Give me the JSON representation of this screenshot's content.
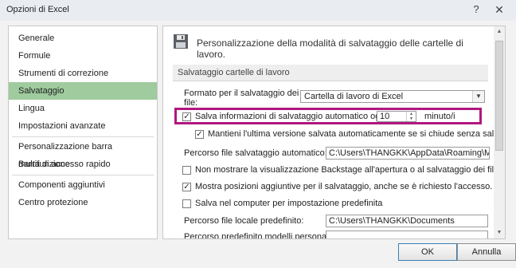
{
  "window": {
    "title": "Opzioni di Excel",
    "help_icon": "question-mark-icon",
    "close_icon": "close-icon"
  },
  "sidebar": {
    "items": [
      {
        "label": "Generale"
      },
      {
        "label": "Formule"
      },
      {
        "label": "Strumenti di correzione"
      },
      {
        "label": "Salvataggio",
        "selected": true
      },
      {
        "label": "Lingua"
      },
      {
        "label": "Impostazioni avanzate"
      },
      {
        "label": "Personalizzazione barra multifunzione"
      },
      {
        "label": "Barra di accesso rapido"
      },
      {
        "label": "Componenti aggiuntivi"
      },
      {
        "label": "Centro protezione"
      }
    ]
  },
  "header": {
    "icon": "floppy-disk-icon",
    "title": "Personalizzazione della modalità di salvataggio delle cartelle di lavoro."
  },
  "section": {
    "title": "Salvataggio cartelle di lavoro"
  },
  "format": {
    "label_line1": "Formato per il salvataggio dei",
    "label_line2": "file:",
    "value": "Cartella di lavoro di Excel"
  },
  "autosave": {
    "label": "Salva informazioni di salvataggio automatico ogni",
    "checked": true,
    "minutes": "10",
    "unit": "minuto/i",
    "highlight_color": "#b0177f"
  },
  "keep_last": {
    "label": "Mantieni l'ultima versione salvata automaticamente se si chiude senza salvare",
    "checked": true
  },
  "autorecover_path": {
    "label": "Percorso file salvataggio automatico:",
    "value": "C:\\Users\\THANGKK\\AppData\\Roaming\\Micr"
  },
  "no_backstage": {
    "label": "Non mostrare la visualizzazione Backstage all'apertura o al salvataggio dei file",
    "checked": false
  },
  "show_additional": {
    "label": "Mostra posizioni aggiuntive per il salvataggio, anche se è richiesto l'accesso.",
    "checked": true
  },
  "save_computer": {
    "label": "Salva nel computer per impostazione predefinita",
    "checked": false
  },
  "default_local": {
    "label": "Percorso file locale predefinito:",
    "value": "C:\\Users\\THANGKK\\Documents"
  },
  "templates_path": {
    "label": "Percorso predefinito modelli personali:",
    "value": ""
  },
  "buttons": {
    "ok": "OK",
    "cancel": "Annulla"
  },
  "colors": {
    "selected_item": "#9fcb9e",
    "highlight": "#b0177f"
  }
}
